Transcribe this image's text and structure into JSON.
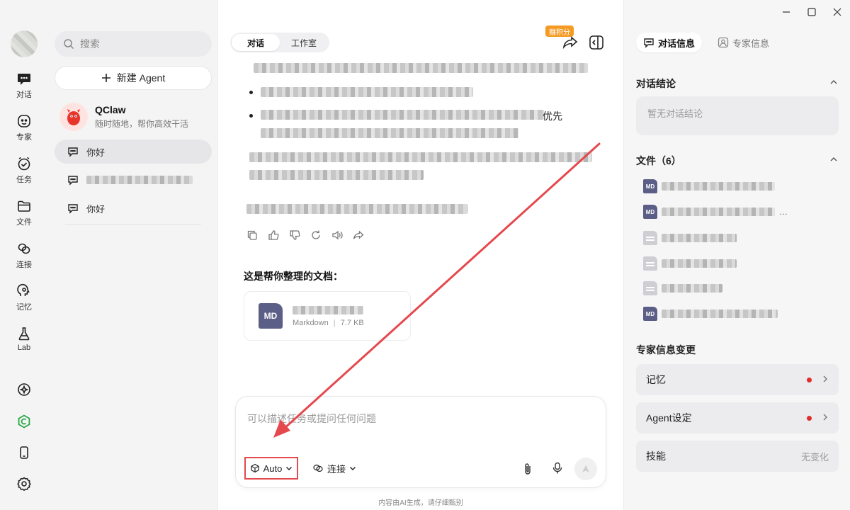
{
  "window": {
    "controls": [
      "minimize",
      "maximize",
      "close"
    ]
  },
  "rail": {
    "items": [
      {
        "label": "对话",
        "icon": "chat-bubble-icon"
      },
      {
        "label": "专家",
        "icon": "expert-icon"
      },
      {
        "label": "任务",
        "icon": "task-icon"
      },
      {
        "label": "文件",
        "icon": "folder-icon"
      },
      {
        "label": "连接",
        "icon": "link-icon"
      },
      {
        "label": "记忆",
        "icon": "memory-icon"
      },
      {
        "label": "Lab",
        "icon": "flask-icon"
      }
    ],
    "bottom_icons": [
      "sparkle-icon",
      "green-logo-icon",
      "phone-icon",
      "settings-icon"
    ]
  },
  "list": {
    "search_placeholder": "搜索",
    "new_agent": "新建 Agent",
    "agent": {
      "name": "QClaw",
      "subtitle": "随时随地，帮你高效干活"
    },
    "conversations": [
      {
        "title": "你好",
        "active": true
      },
      {
        "title": "",
        "active": false
      },
      {
        "title": "你好",
        "active": false
      }
    ]
  },
  "main": {
    "tabs": [
      "对话",
      "工作室"
    ],
    "points_badge": "赚积分",
    "visible_fragment": "优先",
    "doc_heading": "这是帮你整理的文档：",
    "file_card": {
      "badge": "MD",
      "type": "Markdown",
      "size": "7.7 KB"
    },
    "composer": {
      "placeholder": "可以描述任务或提问任何问题",
      "model": "Auto",
      "connect": "连接"
    },
    "disclaimer": "内容由AI生成，请仔细甄别"
  },
  "right": {
    "tabs": [
      "对话信息",
      "专家信息"
    ],
    "conclusion_title": "对话结论",
    "conclusion_empty": "暂无对话结论",
    "files_title": "文件（6）",
    "files": [
      {
        "type": "md",
        "badge": "MD"
      },
      {
        "type": "md",
        "badge": "MD",
        "suffix": "…"
      },
      {
        "type": "doc"
      },
      {
        "type": "doc"
      },
      {
        "type": "doc"
      },
      {
        "type": "md",
        "badge": "MD"
      }
    ],
    "changes_title": "专家信息变更",
    "changes": [
      {
        "label": "记忆",
        "dot": true
      },
      {
        "label": "Agent设定",
        "dot": true
      },
      {
        "label": "技能",
        "status": "无变化"
      }
    ]
  },
  "colors": {
    "accent_red": "#e5484d",
    "badge_orange": "#f59a23",
    "md_purple": "#5b5e86",
    "dot_red": "#e02c2c"
  }
}
